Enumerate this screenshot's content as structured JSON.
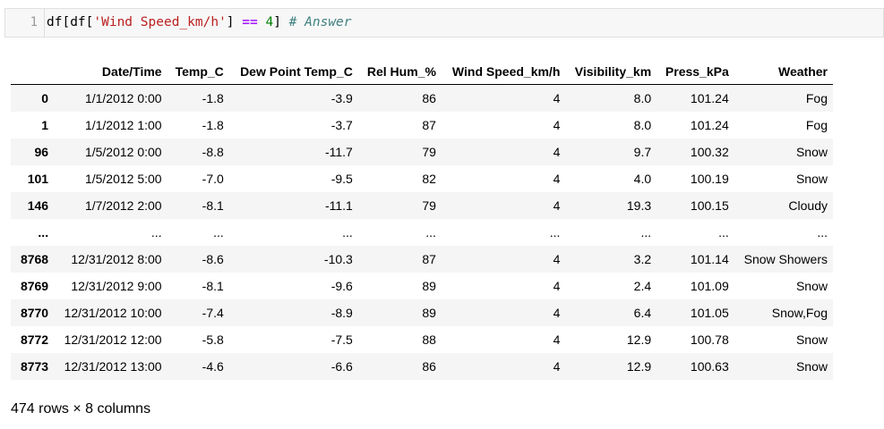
{
  "input_cell": {
    "prompt": "1",
    "code_tokens": [
      {
        "text": "df[df[",
        "cls": ""
      },
      {
        "text": "'Wind Speed_km/h'",
        "cls": "tok-str"
      },
      {
        "text": "] ",
        "cls": ""
      },
      {
        "text": "==",
        "cls": "tok-op"
      },
      {
        "text": " ",
        "cls": ""
      },
      {
        "text": "4",
        "cls": "tok-num"
      },
      {
        "text": "] ",
        "cls": ""
      },
      {
        "text": "# Answer",
        "cls": "tok-com"
      }
    ]
  },
  "table": {
    "columns": [
      "",
      "Date/Time",
      "Temp_C",
      "Dew Point Temp_C",
      "Rel Hum_%",
      "Wind Speed_km/h",
      "Visibility_km",
      "Press_kPa",
      "Weather"
    ],
    "rows": [
      [
        "0",
        "1/1/2012 0:00",
        "-1.8",
        "-3.9",
        "86",
        "4",
        "8.0",
        "101.24",
        "Fog"
      ],
      [
        "1",
        "1/1/2012 1:00",
        "-1.8",
        "-3.7",
        "87",
        "4",
        "8.0",
        "101.24",
        "Fog"
      ],
      [
        "96",
        "1/5/2012 0:00",
        "-8.8",
        "-11.7",
        "79",
        "4",
        "9.7",
        "100.32",
        "Snow"
      ],
      [
        "101",
        "1/5/2012 5:00",
        "-7.0",
        "-9.5",
        "82",
        "4",
        "4.0",
        "100.19",
        "Snow"
      ],
      [
        "146",
        "1/7/2012 2:00",
        "-8.1",
        "-11.1",
        "79",
        "4",
        "19.3",
        "100.15",
        "Cloudy"
      ],
      [
        "...",
        "...",
        "...",
        "...",
        "...",
        "...",
        "...",
        "...",
        "..."
      ],
      [
        "8768",
        "12/31/2012 8:00",
        "-8.6",
        "-10.3",
        "87",
        "4",
        "3.2",
        "101.14",
        "Snow Showers"
      ],
      [
        "8769",
        "12/31/2012 9:00",
        "-8.1",
        "-9.6",
        "89",
        "4",
        "2.4",
        "101.09",
        "Snow"
      ],
      [
        "8770",
        "12/31/2012 10:00",
        "-7.4",
        "-8.9",
        "89",
        "4",
        "6.4",
        "101.05",
        "Snow,Fog"
      ],
      [
        "8772",
        "12/31/2012 12:00",
        "-5.8",
        "-7.5",
        "88",
        "4",
        "12.9",
        "100.78",
        "Snow"
      ],
      [
        "8773",
        "12/31/2012 13:00",
        "-4.6",
        "-6.6",
        "86",
        "4",
        "12.9",
        "100.63",
        "Snow"
      ]
    ]
  },
  "summary": "474 rows × 8 columns"
}
